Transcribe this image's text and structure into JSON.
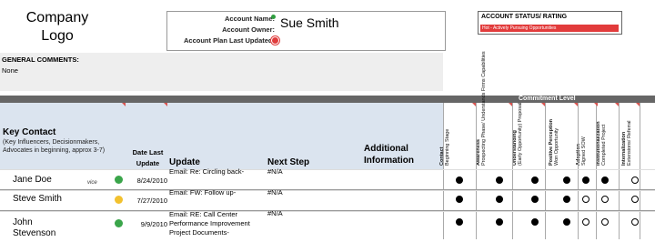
{
  "logo": "Company\nLogo",
  "account": {
    "name_label": "Account Name:",
    "owner_label": "Account Owner:",
    "updated_label": "Account Plan Last Updated:",
    "name_value": "Sue Smith"
  },
  "status": {
    "title": "ACCOUNT STATUS/ RATING",
    "value": "Hot - Actively Pursuing Opportunities",
    "color": "#e23b3b"
  },
  "general_comments": {
    "title": "GENERAL COMMENTS:",
    "value": "None"
  },
  "commitment_level": "Commitment Level",
  "headers": {
    "key_contact": "Key Contact",
    "key_contact_sub": "(Key Influencers, Decisionmakers, Advocates in beginning, approx 3-7)",
    "date_last_update": "Date Last Update",
    "update": "Update",
    "next_step": "Next Step",
    "additional_info": "Additional Information"
  },
  "commitment_columns": [
    {
      "title": "Contact",
      "sub": "Beginning Stage"
    },
    {
      "title": "Awareness",
      "sub": "Prospecting Phase/ Understands Firms Capabilities"
    },
    {
      "title": "Understanding",
      "sub": "(Early Opportunity) Proposal"
    },
    {
      "title": "Positive Perception",
      "sub": "Won Opportunity"
    },
    {
      "title": "Adoption",
      "sub": "Signed SOW"
    },
    {
      "title": "Institutionalization",
      "sub": "Completed Project"
    },
    {
      "title": "Internalization",
      "sub": "Extensions/ Referral"
    }
  ],
  "rows": [
    {
      "name": "Jane Doe",
      "status_color": "#3aa54a",
      "date": "8/24/2010",
      "update": "Email: Re: Circling back-",
      "next": "#N/A",
      "ghost": "vice",
      "levels": [
        1,
        1,
        1,
        1,
        1,
        1,
        0
      ]
    },
    {
      "name": "Steve Smith",
      "status_color": "#f2c12e",
      "date": "7/27/2010",
      "update": "Email: FW: Follow up-",
      "next": "#N/A",
      "ghost": "",
      "levels": [
        1,
        1,
        1,
        1,
        0,
        0,
        0
      ]
    },
    {
      "name": "John\nStevenson",
      "status_color": "#3aa54a",
      "date": "9/9/2010",
      "update": "Email: RE: Call Center\nPerformance Improvement\nProject Documents-",
      "next": "#N/A",
      "ghost": "",
      "levels": [
        1,
        1,
        1,
        1,
        0,
        0,
        0
      ]
    }
  ]
}
